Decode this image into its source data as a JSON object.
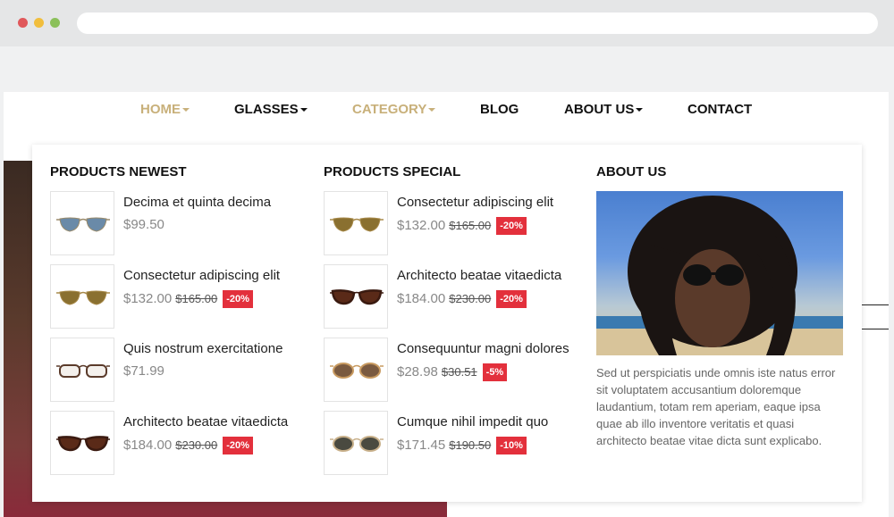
{
  "nav": {
    "items": [
      {
        "label": "HOME",
        "caret": true,
        "active": true
      },
      {
        "label": "GLASSES",
        "caret": true,
        "active": false
      },
      {
        "label": "CATEGORY",
        "caret": true,
        "active": true
      },
      {
        "label": "BLOG",
        "caret": false,
        "active": false
      },
      {
        "label": "ABOUT US",
        "caret": true,
        "active": false
      },
      {
        "label": "CONTACT",
        "caret": false,
        "active": false
      }
    ]
  },
  "menu": {
    "newest": {
      "title": "PRODUCTS NEWEST",
      "products": [
        {
          "name": "Decima et quinta decima",
          "price": "$99.50",
          "old": "",
          "badge": "",
          "glasses": "aviator-blue"
        },
        {
          "name": "Consectetur adipiscing elit",
          "price": "$132.00",
          "old": "$165.00",
          "badge": "-20%",
          "glasses": "aviator-gold"
        },
        {
          "name": "Quis nostrum exercitatione",
          "price": "$71.99",
          "old": "",
          "badge": "",
          "glasses": "clear-frame"
        },
        {
          "name": "Architecto beatae vitaedicta",
          "price": "$184.00",
          "old": "$230.00",
          "badge": "-20%",
          "glasses": "cateye-brown"
        }
      ]
    },
    "special": {
      "title": "PRODUCTS SPECIAL",
      "products": [
        {
          "name": "Consectetur adipiscing elit",
          "price": "$132.00",
          "old": "$165.00",
          "badge": "-20%",
          "glasses": "aviator-gold"
        },
        {
          "name": "Architecto beatae vitaedicta",
          "price": "$184.00",
          "old": "$230.00",
          "badge": "-20%",
          "glasses": "cateye-brown"
        },
        {
          "name": "Consequuntur magni dolores",
          "price": "$28.98",
          "old": "$30.51",
          "badge": "-5%",
          "glasses": "tortoise-tan"
        },
        {
          "name": "Cumque nihil impedit quo",
          "price": "$171.45",
          "old": "$190.50",
          "badge": "-10%",
          "glasses": "round-dark"
        }
      ]
    },
    "about": {
      "title": "ABOUT US",
      "text": "Sed ut perspiciatis unde omnis iste natus error sit voluptatem accusantium doloremque laudantium, totam rem aperiam, eaque ipsa quae ab illo inventore veritatis et quasi architecto beatae vitae dicta sunt explicabo."
    }
  },
  "colors": {
    "accent": "#c8b07a",
    "badge": "#e3303c"
  }
}
